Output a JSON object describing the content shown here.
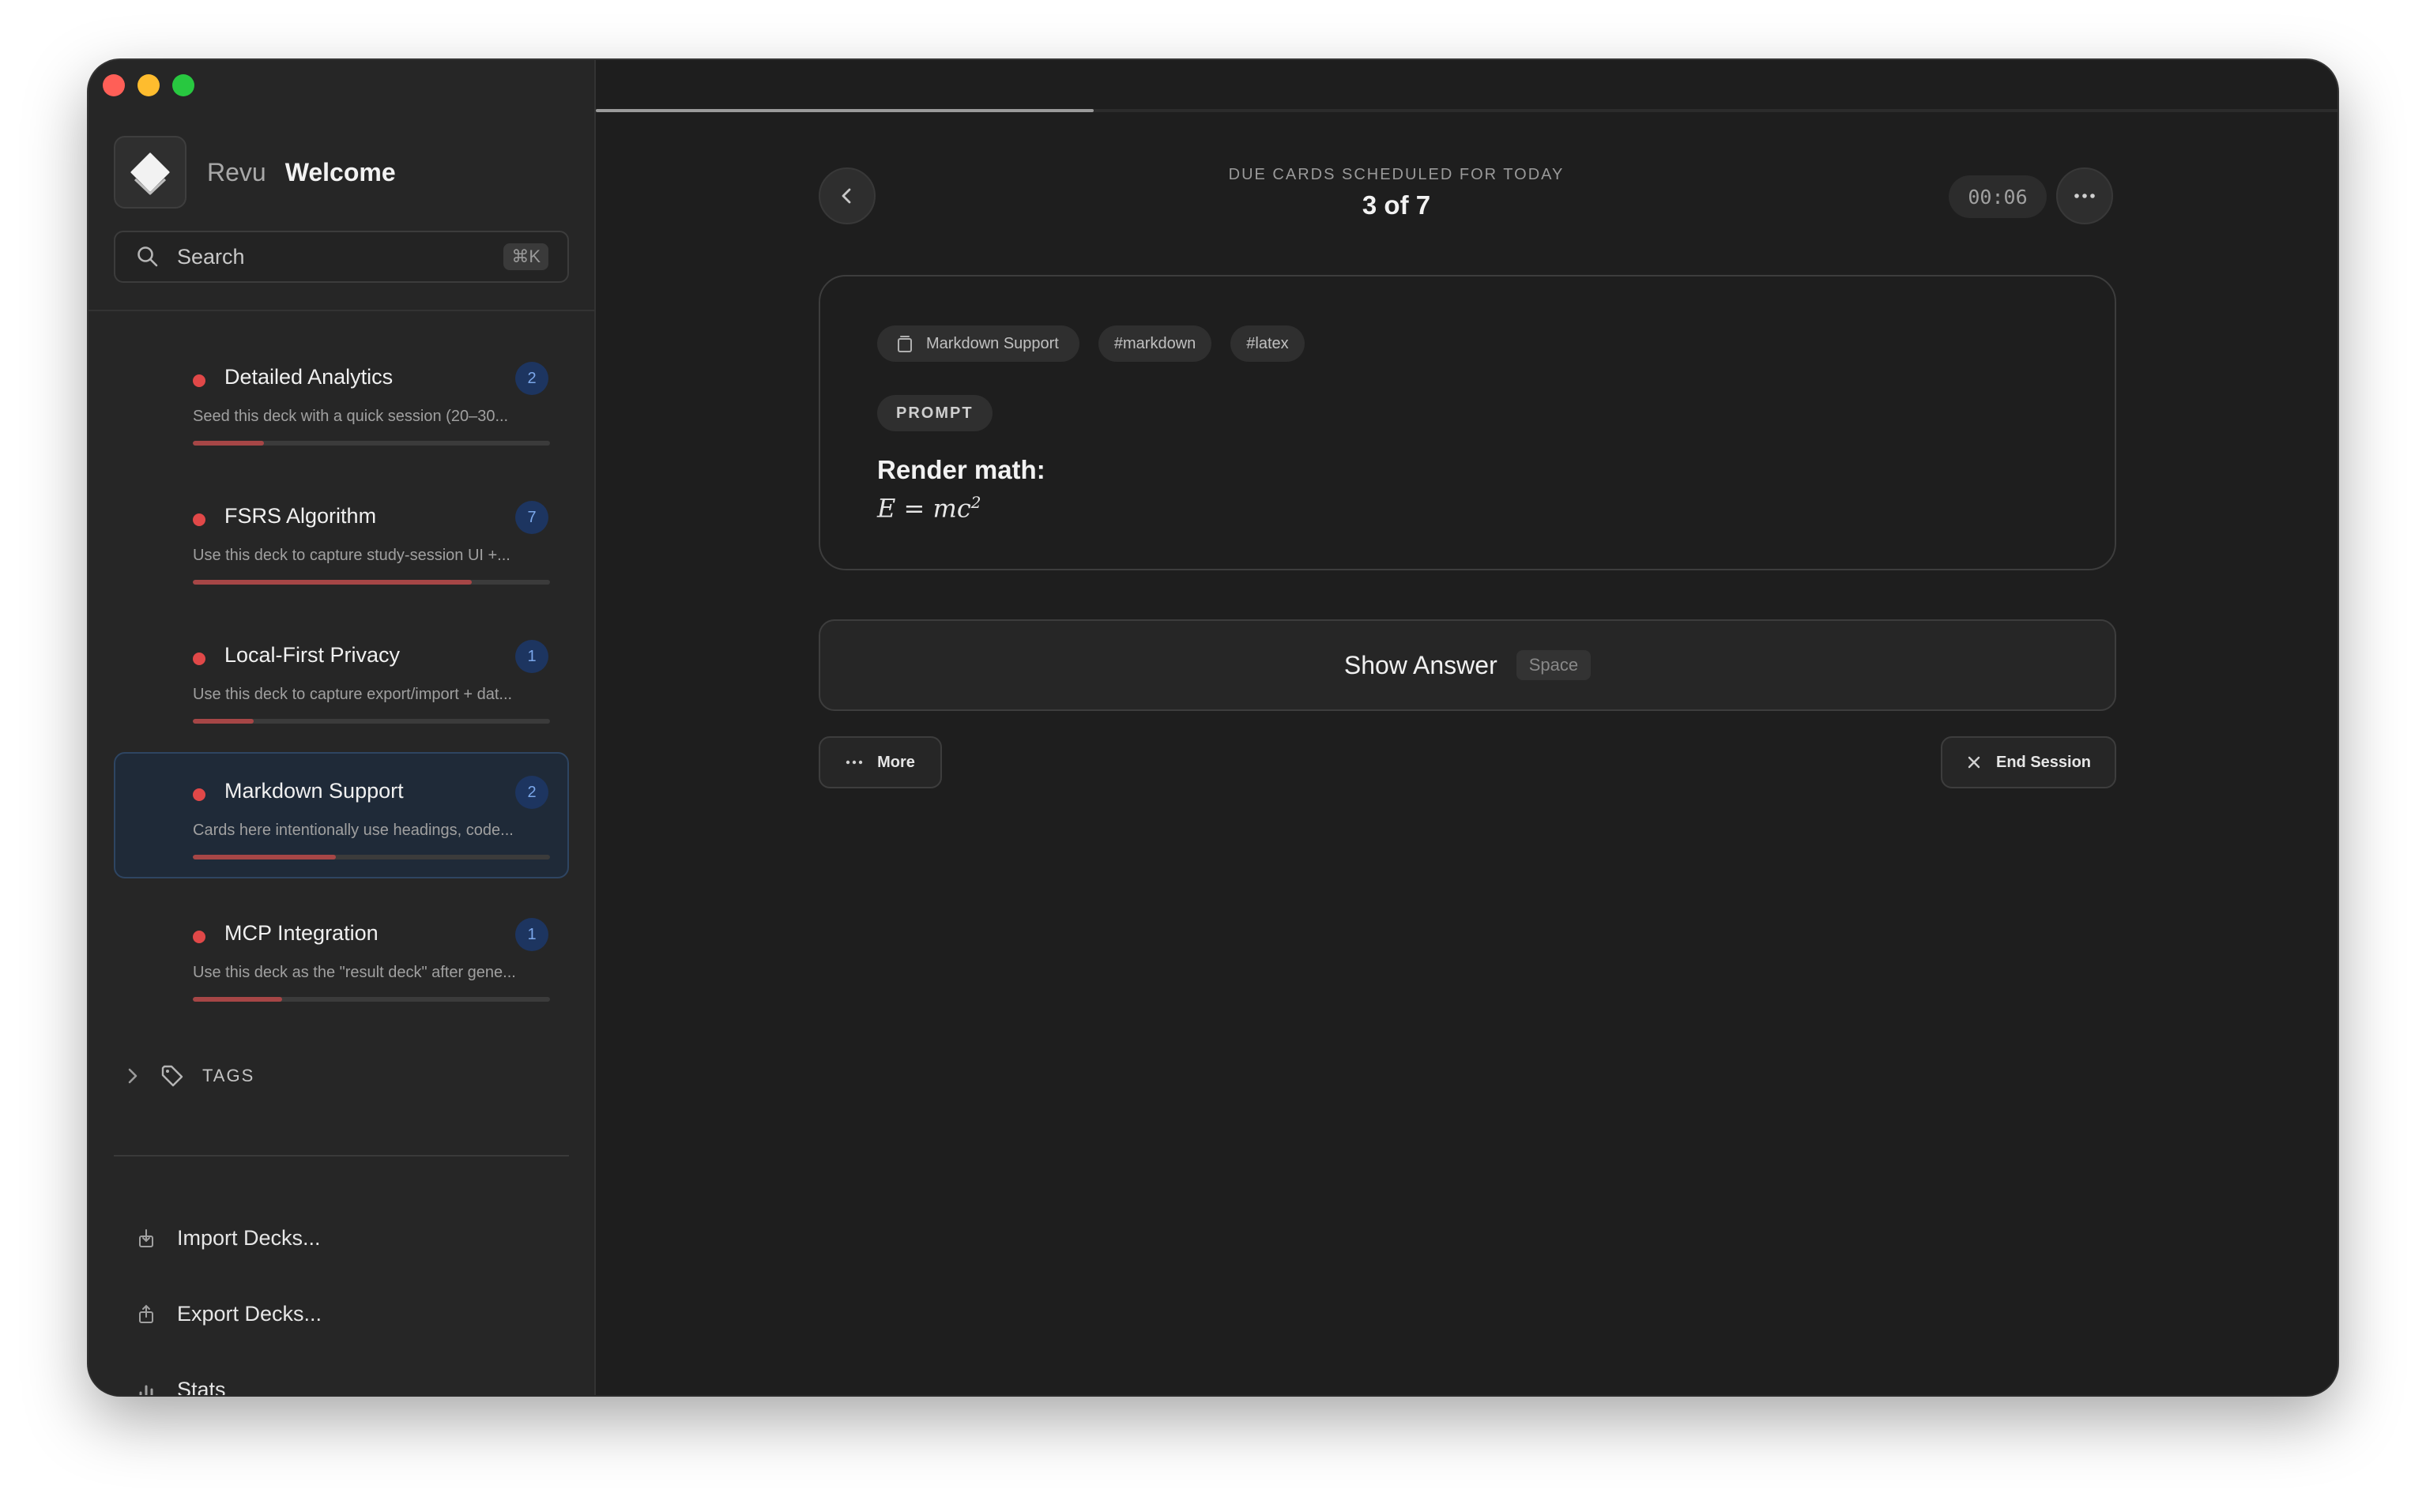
{
  "app": {
    "name": "Revu",
    "page_title": "Welcome"
  },
  "search": {
    "placeholder": "Search",
    "shortcut": "⌘K"
  },
  "decks": [
    {
      "title": "Detailed Analytics",
      "count": "2",
      "description": "Seed this deck with a quick session (20–30...",
      "progress": 0.2,
      "active": false
    },
    {
      "title": "FSRS Algorithm",
      "count": "7",
      "description": "Use this deck to capture study-session UI +...",
      "progress": 0.78,
      "active": false
    },
    {
      "title": "Local-First Privacy",
      "count": "1",
      "description": "Use this deck to capture export/import + dat...",
      "progress": 0.17,
      "active": false
    },
    {
      "title": "Markdown Support",
      "count": "2",
      "description": "Cards here intentionally use headings, code...",
      "progress": 0.4,
      "active": true
    },
    {
      "title": "MCP Integration",
      "count": "1",
      "description": "Use this deck as the \"result deck\" after gene...",
      "progress": 0.25,
      "active": false
    }
  ],
  "tags_section": {
    "label": "TAGS"
  },
  "sidebar_links": {
    "import": "Import Decks...",
    "export": "Export Decks...",
    "stats": "Stats"
  },
  "session": {
    "label": "DUE CARDS SCHEDULED FOR TODAY",
    "progress_text": "3 of 7",
    "progress_fraction": 0.2857,
    "timer": "00:06"
  },
  "card": {
    "deck_chip": "Markdown Support",
    "tags": [
      "#markdown",
      "#latex"
    ],
    "side_label": "PROMPT",
    "heading": "Render math:",
    "math_base": "E = mc",
    "math_exp": "2"
  },
  "actions": {
    "show_answer": "Show Answer",
    "show_answer_key": "Space",
    "more": "More",
    "end_session": "End Session"
  },
  "colors": {
    "accent_red": "#e04848",
    "count_badge": "#1d3560",
    "active_deck_bg": "#1f2a38"
  }
}
